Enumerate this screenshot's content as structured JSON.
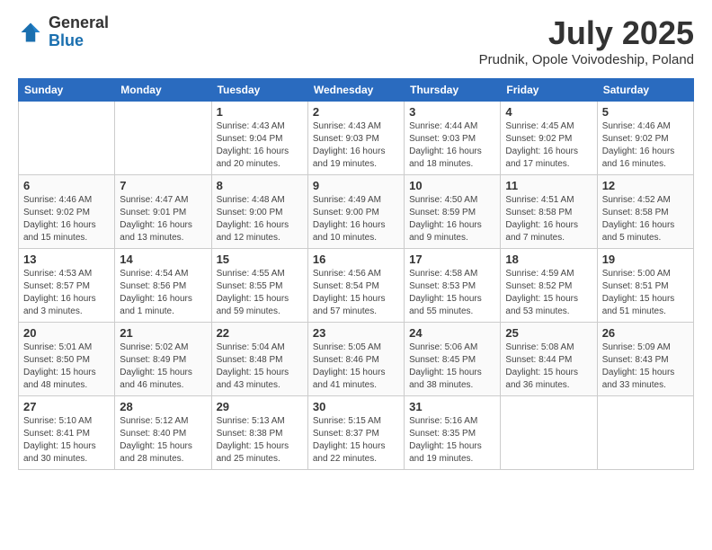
{
  "header": {
    "logo_general": "General",
    "logo_blue": "Blue",
    "title": "July 2025",
    "location": "Prudnik, Opole Voivodeship, Poland"
  },
  "days_of_week": [
    "Sunday",
    "Monday",
    "Tuesday",
    "Wednesday",
    "Thursday",
    "Friday",
    "Saturday"
  ],
  "weeks": [
    [
      {
        "day": "",
        "info": ""
      },
      {
        "day": "",
        "info": ""
      },
      {
        "day": "1",
        "info": "Sunrise: 4:43 AM\nSunset: 9:04 PM\nDaylight: 16 hours\nand 20 minutes."
      },
      {
        "day": "2",
        "info": "Sunrise: 4:43 AM\nSunset: 9:03 PM\nDaylight: 16 hours\nand 19 minutes."
      },
      {
        "day": "3",
        "info": "Sunrise: 4:44 AM\nSunset: 9:03 PM\nDaylight: 16 hours\nand 18 minutes."
      },
      {
        "day": "4",
        "info": "Sunrise: 4:45 AM\nSunset: 9:02 PM\nDaylight: 16 hours\nand 17 minutes."
      },
      {
        "day": "5",
        "info": "Sunrise: 4:46 AM\nSunset: 9:02 PM\nDaylight: 16 hours\nand 16 minutes."
      }
    ],
    [
      {
        "day": "6",
        "info": "Sunrise: 4:46 AM\nSunset: 9:02 PM\nDaylight: 16 hours\nand 15 minutes."
      },
      {
        "day": "7",
        "info": "Sunrise: 4:47 AM\nSunset: 9:01 PM\nDaylight: 16 hours\nand 13 minutes."
      },
      {
        "day": "8",
        "info": "Sunrise: 4:48 AM\nSunset: 9:00 PM\nDaylight: 16 hours\nand 12 minutes."
      },
      {
        "day": "9",
        "info": "Sunrise: 4:49 AM\nSunset: 9:00 PM\nDaylight: 16 hours\nand 10 minutes."
      },
      {
        "day": "10",
        "info": "Sunrise: 4:50 AM\nSunset: 8:59 PM\nDaylight: 16 hours\nand 9 minutes."
      },
      {
        "day": "11",
        "info": "Sunrise: 4:51 AM\nSunset: 8:58 PM\nDaylight: 16 hours\nand 7 minutes."
      },
      {
        "day": "12",
        "info": "Sunrise: 4:52 AM\nSunset: 8:58 PM\nDaylight: 16 hours\nand 5 minutes."
      }
    ],
    [
      {
        "day": "13",
        "info": "Sunrise: 4:53 AM\nSunset: 8:57 PM\nDaylight: 16 hours\nand 3 minutes."
      },
      {
        "day": "14",
        "info": "Sunrise: 4:54 AM\nSunset: 8:56 PM\nDaylight: 16 hours\nand 1 minute."
      },
      {
        "day": "15",
        "info": "Sunrise: 4:55 AM\nSunset: 8:55 PM\nDaylight: 15 hours\nand 59 minutes."
      },
      {
        "day": "16",
        "info": "Sunrise: 4:56 AM\nSunset: 8:54 PM\nDaylight: 15 hours\nand 57 minutes."
      },
      {
        "day": "17",
        "info": "Sunrise: 4:58 AM\nSunset: 8:53 PM\nDaylight: 15 hours\nand 55 minutes."
      },
      {
        "day": "18",
        "info": "Sunrise: 4:59 AM\nSunset: 8:52 PM\nDaylight: 15 hours\nand 53 minutes."
      },
      {
        "day": "19",
        "info": "Sunrise: 5:00 AM\nSunset: 8:51 PM\nDaylight: 15 hours\nand 51 minutes."
      }
    ],
    [
      {
        "day": "20",
        "info": "Sunrise: 5:01 AM\nSunset: 8:50 PM\nDaylight: 15 hours\nand 48 minutes."
      },
      {
        "day": "21",
        "info": "Sunrise: 5:02 AM\nSunset: 8:49 PM\nDaylight: 15 hours\nand 46 minutes."
      },
      {
        "day": "22",
        "info": "Sunrise: 5:04 AM\nSunset: 8:48 PM\nDaylight: 15 hours\nand 43 minutes."
      },
      {
        "day": "23",
        "info": "Sunrise: 5:05 AM\nSunset: 8:46 PM\nDaylight: 15 hours\nand 41 minutes."
      },
      {
        "day": "24",
        "info": "Sunrise: 5:06 AM\nSunset: 8:45 PM\nDaylight: 15 hours\nand 38 minutes."
      },
      {
        "day": "25",
        "info": "Sunrise: 5:08 AM\nSunset: 8:44 PM\nDaylight: 15 hours\nand 36 minutes."
      },
      {
        "day": "26",
        "info": "Sunrise: 5:09 AM\nSunset: 8:43 PM\nDaylight: 15 hours\nand 33 minutes."
      }
    ],
    [
      {
        "day": "27",
        "info": "Sunrise: 5:10 AM\nSunset: 8:41 PM\nDaylight: 15 hours\nand 30 minutes."
      },
      {
        "day": "28",
        "info": "Sunrise: 5:12 AM\nSunset: 8:40 PM\nDaylight: 15 hours\nand 28 minutes."
      },
      {
        "day": "29",
        "info": "Sunrise: 5:13 AM\nSunset: 8:38 PM\nDaylight: 15 hours\nand 25 minutes."
      },
      {
        "day": "30",
        "info": "Sunrise: 5:15 AM\nSunset: 8:37 PM\nDaylight: 15 hours\nand 22 minutes."
      },
      {
        "day": "31",
        "info": "Sunrise: 5:16 AM\nSunset: 8:35 PM\nDaylight: 15 hours\nand 19 minutes."
      },
      {
        "day": "",
        "info": ""
      },
      {
        "day": "",
        "info": ""
      }
    ]
  ]
}
